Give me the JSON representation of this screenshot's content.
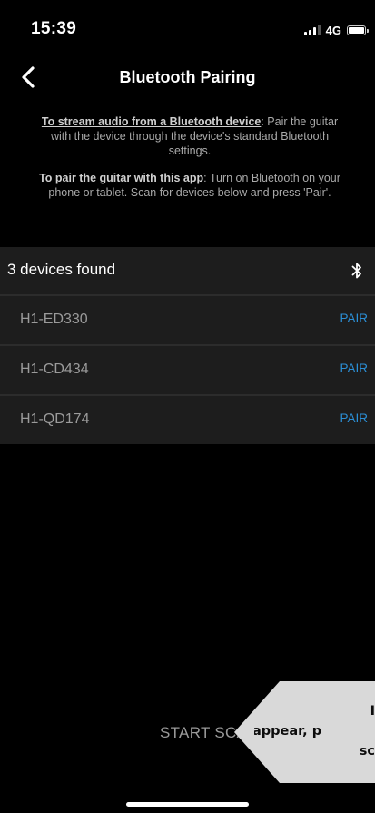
{
  "status_bar": {
    "time": "15:39",
    "network": "4G",
    "signal_bars": 4,
    "battery_level": "full",
    "signal-icon": "cellular-signal-icon",
    "battery-icon": "battery-icon"
  },
  "nav": {
    "title": "Bluetooth Pairing",
    "back_icon": "chevron-left-icon"
  },
  "instructions": {
    "stream_heading": "To stream audio from a Bluetooth device",
    "stream_text": ": Pair the guitar with the device through the device's standard Bluetooth settings.",
    "pair_heading": "To pair the guitar with this app",
    "pair_text": ": Turn on Bluetooth on your phone or tablet. Scan for devices below and press 'Pair'."
  },
  "devices": {
    "header": "3 devices found",
    "header_icon": "bluetooth-icon",
    "items": [
      {
        "name": "H1-ED330",
        "action": "PAIR"
      },
      {
        "name": "H1-CD434",
        "action": "PAIR"
      },
      {
        "name": "H1-QD174",
        "action": "PAIR"
      }
    ]
  },
  "scan_button": "START SCAN",
  "tooltip": {
    "line1": "I",
    "line2": "appear, p",
    "line3": "sc"
  },
  "colors": {
    "background": "#000000",
    "row_background": "#1d1d1d",
    "accent": "#2b8fd6",
    "muted_text": "#9b9b9b",
    "tooltip_bg": "#d9d9d9"
  }
}
